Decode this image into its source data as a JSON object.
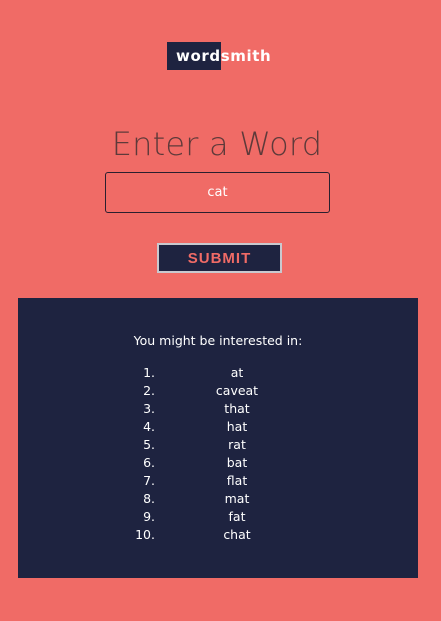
{
  "logo": {
    "part_a": "word",
    "part_b": "smith"
  },
  "heading": "Enter a Word",
  "input": {
    "value": "cat"
  },
  "submit_label": "SUBMIT",
  "results": {
    "title": "You might be interested in:",
    "items": [
      {
        "num": "1.",
        "word": "at"
      },
      {
        "num": "2.",
        "word": "caveat"
      },
      {
        "num": "3.",
        "word": "that"
      },
      {
        "num": "4.",
        "word": "hat"
      },
      {
        "num": "5.",
        "word": "rat"
      },
      {
        "num": "6.",
        "word": "bat"
      },
      {
        "num": "7.",
        "word": "flat"
      },
      {
        "num": "8.",
        "word": "mat"
      },
      {
        "num": "9.",
        "word": "fat"
      },
      {
        "num": "10.",
        "word": "chat"
      }
    ]
  },
  "colors": {
    "background": "#f06b66",
    "panel": "#1e2340",
    "accent": "#f06b66"
  }
}
